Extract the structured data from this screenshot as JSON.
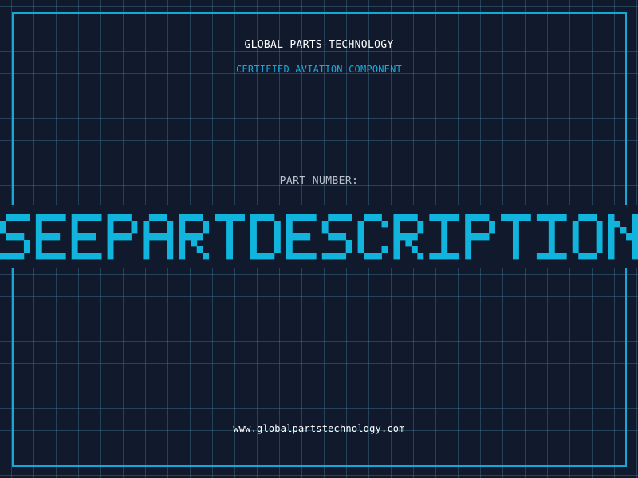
{
  "header": {
    "company": "GLOBAL PARTS-TECHNOLOGY",
    "subtitle": "CERTIFIED AVIATION COMPONENT"
  },
  "part": {
    "label": "PART NUMBER:",
    "value": "SEEPARTDESCRIPTION"
  },
  "footer": {
    "website": "www.globalpartstechnology.com"
  },
  "colors": {
    "background": "#111a2c",
    "grid": "#3f7f9e",
    "accent": "#14a8d8",
    "part_number": "#10b4dc",
    "text": "#ffffff",
    "label": "#b9c2cf"
  }
}
